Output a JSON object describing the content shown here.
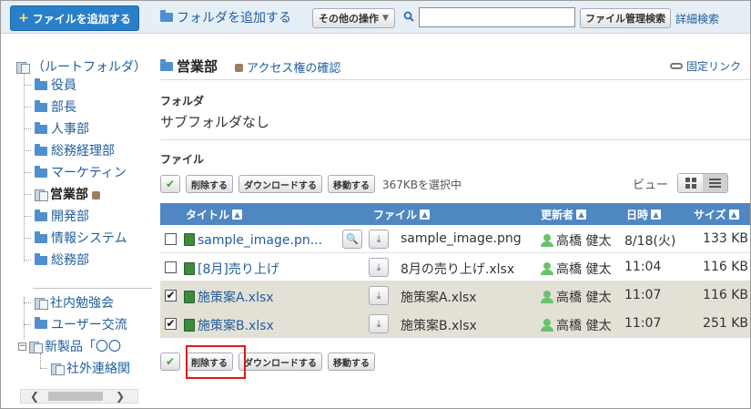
{
  "toolbar": {
    "add_file": "ファイルを追加する",
    "add_folder": "フォルダを追加する",
    "other_ops": "その他の操作",
    "search_value": "",
    "file_search": "ファイル管理検索",
    "advanced_search": "詳細検索"
  },
  "tree": {
    "root": "（ルートフォルダ）",
    "items": [
      "役員",
      "部長",
      "人事部",
      "総務経理部",
      "マーケティン",
      "営業部",
      "開発部",
      "情報システム",
      "総務部"
    ],
    "group2": [
      "社内勉強会",
      "ユーザー交流",
      "新製品「〇〇"
    ],
    "child": "社外連絡関"
  },
  "main": {
    "folder_name": "営業部",
    "access_check": "アクセス権の確認",
    "permalink": "固定リンク",
    "folder_label": "フォルダ",
    "no_subfolder": "サブフォルダなし",
    "file_label": "ファイル",
    "actions": {
      "delete": "削除する",
      "download": "ダウンロードする",
      "move": "移動する"
    },
    "selected_info": "367KBを選択中",
    "view_label": "ビュー"
  },
  "table": {
    "headers": {
      "title": "タイトル",
      "file": "ファイル",
      "updater": "更新者",
      "date": "日時",
      "size": "サイズ"
    },
    "rows": [
      {
        "checked": false,
        "title": "sample_image.pn...",
        "file": "sample_image.png",
        "updater": "高橋 健太",
        "date": "8/18(火)",
        "size": "133 KB"
      },
      {
        "checked": false,
        "title": "[8月]売り上げ",
        "file": "8月の売り上げ.xlsx",
        "updater": "高橋 健太",
        "date": "11:04",
        "size": "116 KB"
      },
      {
        "checked": true,
        "title": "施策案A.xlsx",
        "file": "施策案A.xlsx",
        "updater": "高橋 健太",
        "date": "11:07",
        "size": "116 KB"
      },
      {
        "checked": true,
        "title": "施策案B.xlsx",
        "file": "施策案B.xlsx",
        "updater": "高橋 健太",
        "date": "11:07",
        "size": "251 KB"
      }
    ]
  },
  "colors": {
    "accent": "#4f87c2",
    "highlight": "#e01818",
    "selected_row": "#e3e0d6"
  }
}
